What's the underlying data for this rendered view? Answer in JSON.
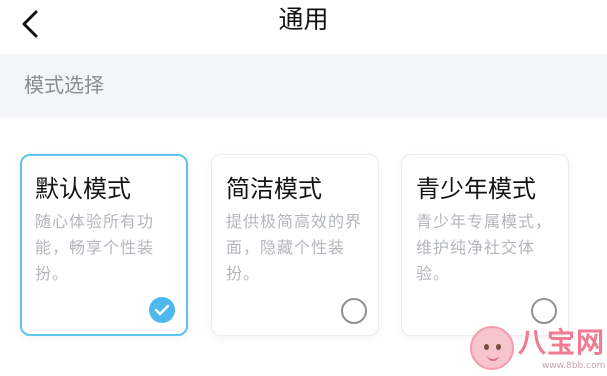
{
  "header": {
    "title": "通用",
    "back_icon": "chevron-left-icon"
  },
  "section": {
    "label": "模式选择"
  },
  "modes": [
    {
      "title": "默认模式",
      "description": "随心体验所有功能，畅享个性装扮。",
      "selected": true
    },
    {
      "title": "简洁模式",
      "description": "提供极简高效的界面，隐藏个性装扮。",
      "selected": false
    },
    {
      "title": "青少年模式",
      "description": "青少年专属模式，维护纯净社交体验。",
      "selected": false
    }
  ],
  "colors": {
    "accent": "#4db8ee",
    "selected_border": "#5bc3ee",
    "section_bg": "#f4f5f8",
    "muted_text": "#b3b6bb"
  },
  "watermark": {
    "text": "八宝网",
    "url": "www.8bb.com"
  }
}
